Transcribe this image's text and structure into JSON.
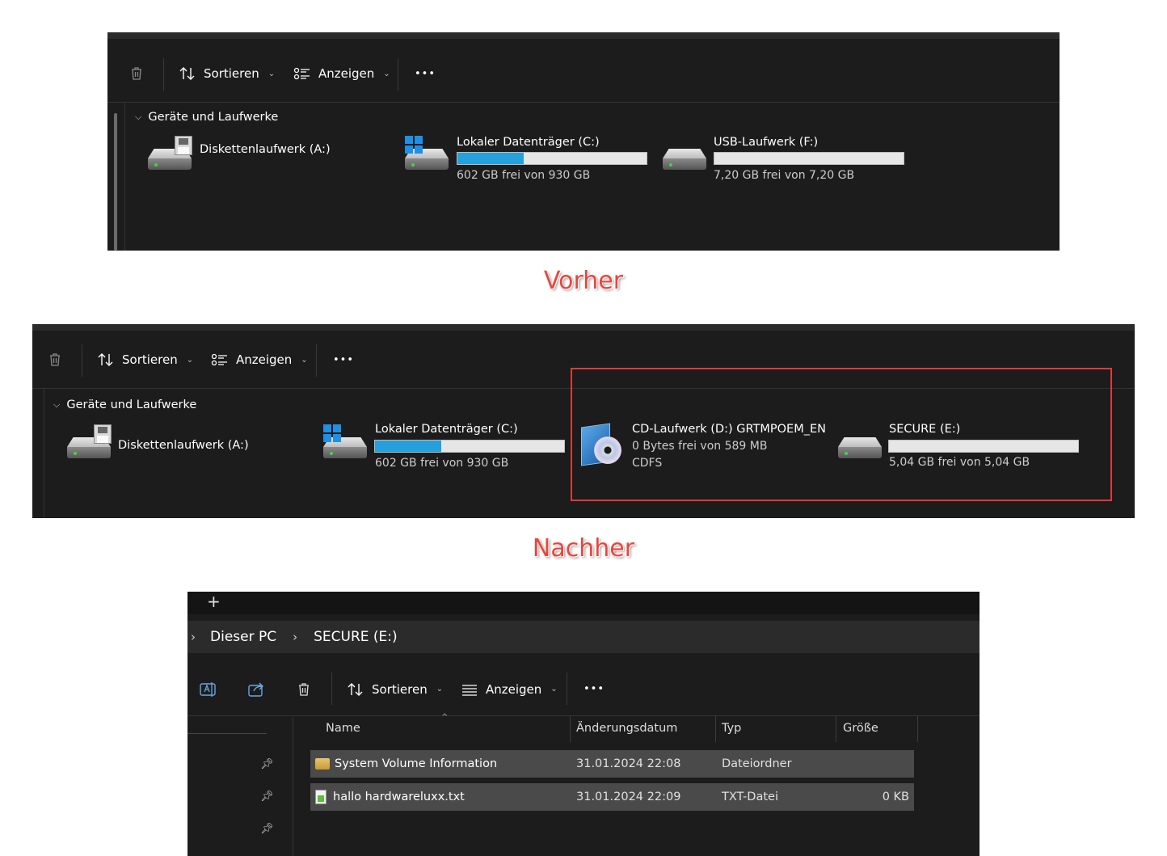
{
  "toolbar": {
    "sort_label": "Sortieren",
    "view_label": "Anzeigen",
    "more_label": "•••"
  },
  "before": {
    "section_title": "Geräte und Laufwerke",
    "drives": [
      {
        "name": "Diskettenlaufwerk (A:)"
      },
      {
        "name": "Lokaler Datenträger (C:)",
        "free": "602 GB frei von 930 GB",
        "used_fraction": 0.35
      },
      {
        "name": "USB-Laufwerk (F:)",
        "free": "7,20 GB frei von 7,20 GB",
        "used_fraction": 0.0
      }
    ]
  },
  "caption_before": "Vorher",
  "after": {
    "section_title": "Geräte und Laufwerke",
    "drives": [
      {
        "name": "Diskettenlaufwerk (A:)"
      },
      {
        "name": "Lokaler Datenträger (C:)",
        "free": "602 GB frei von 930 GB",
        "used_fraction": 0.35
      },
      {
        "name": "CD-Laufwerk (D:) GRTMPOEM_EN",
        "free": "0 Bytes frei von 589 MB",
        "fs": "CDFS"
      },
      {
        "name": "SECURE (E:)",
        "free": "5,04 GB frei von 5,04 GB",
        "used_fraction": 0.0
      }
    ],
    "highlight_color": "#e03a3a"
  },
  "caption_after": "Nachher",
  "explorer": {
    "new_tab": "+",
    "breadcrumb": [
      "Dieser PC",
      "SECURE (E:)"
    ],
    "columns": [
      "Name",
      "Änderungsdatum",
      "Typ",
      "Größe"
    ],
    "rows": [
      {
        "name": "System Volume Information",
        "date": "31.01.2024 22:08",
        "type": "Dateiordner",
        "size": ""
      },
      {
        "name": "hallo hardwareluxx.txt",
        "date": "31.01.2024 22:09",
        "type": "TXT-Datei",
        "size": "0 KB"
      }
    ]
  },
  "colors": {
    "panel_bg": "#1c1c1c",
    "accent": "#26a0da",
    "caption": "#e8453c"
  }
}
